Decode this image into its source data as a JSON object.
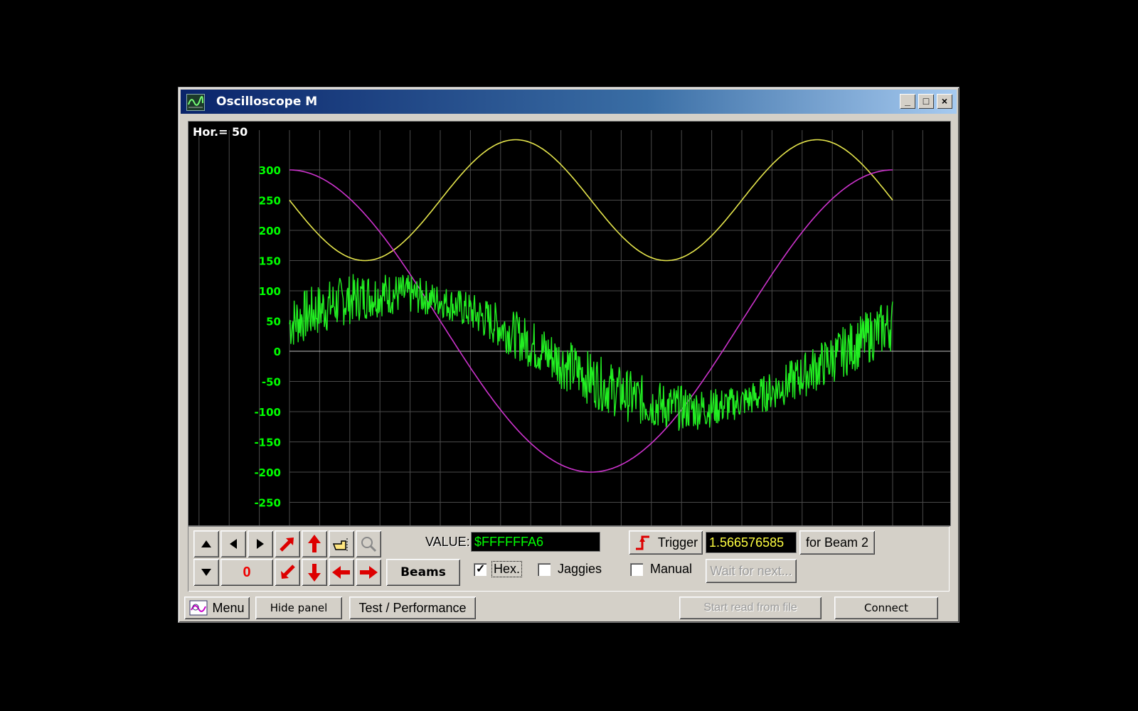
{
  "window": {
    "title": "Oscilloscope M"
  },
  "titlebar_buttons": {
    "minimize": "_",
    "maximize": "□",
    "close": "×"
  },
  "screen": {
    "hor_label": "Hor.= 50",
    "y_ticks": [
      "300",
      "250",
      "200",
      "150",
      "100",
      "50",
      "0",
      "-50",
      "-100",
      "-150",
      "-200",
      "-250"
    ],
    "colors": {
      "background": "#000000",
      "grid": "#4a4a4a",
      "tick_label": "#00ff00",
      "zero_line": "#c0c0c0"
    }
  },
  "chart_data": {
    "type": "line",
    "ylim": [
      -250,
      300
    ],
    "y_ticks": [
      300,
      250,
      200,
      150,
      100,
      50,
      0,
      -50,
      -100,
      -150,
      -200,
      -250
    ],
    "grid": true,
    "series": [
      {
        "color": "#e6e64c",
        "shape": "sine",
        "offset": 250,
        "amplitude": 100,
        "min": 150,
        "max": 350,
        "cycles": 2,
        "points": [
          [
            0,
            250
          ],
          [
            0.125,
            150
          ],
          [
            0.25,
            250
          ],
          [
            0.375,
            350
          ],
          [
            0.5,
            250
          ],
          [
            0.625,
            150
          ],
          [
            0.75,
            250
          ],
          [
            0.875,
            350
          ],
          [
            1,
            250
          ]
        ]
      },
      {
        "color": "#cc33cc",
        "shape": "cosine",
        "offset": 50,
        "amplitude": 250,
        "min": -200,
        "max": 300,
        "cycles": 1,
        "points": [
          [
            0,
            300
          ],
          [
            0.25,
            50
          ],
          [
            0.5,
            -200
          ],
          [
            0.75,
            50
          ],
          [
            1,
            300
          ]
        ]
      },
      {
        "color": "#22ee22",
        "shape": "noisy-sine",
        "offset": 0,
        "amplitude": 100,
        "noise": 45,
        "cycles": 1,
        "points": [
          [
            0,
            50
          ],
          [
            0.125,
            85
          ],
          [
            0.25,
            100
          ],
          [
            0.375,
            75
          ],
          [
            0.5,
            0
          ],
          [
            0.625,
            -75
          ],
          [
            0.75,
            -100
          ],
          [
            0.875,
            -70
          ],
          [
            1,
            40
          ]
        ]
      }
    ]
  },
  "panel": {
    "zero_value": "0",
    "beams_label": "Beams",
    "value_label": "VALUE:",
    "value_text": "$FFFFFFA6",
    "hex_label": "Hex.",
    "hex_checked": true,
    "jaggies_label": "Jaggies",
    "jaggies_checked": false,
    "trigger_label": "Trigger",
    "trigger_value": "1.566576585",
    "for_beam_label": "for Beam 2",
    "manual_label": "Manual",
    "manual_checked": false,
    "wait_label": "Wait for next..."
  },
  "footer": {
    "menu_label": "Menu",
    "hide_panel_label": "Hide panel",
    "test_label": "Test / Performance",
    "start_read_label": "Start read from file",
    "connect_label": "Connect"
  }
}
